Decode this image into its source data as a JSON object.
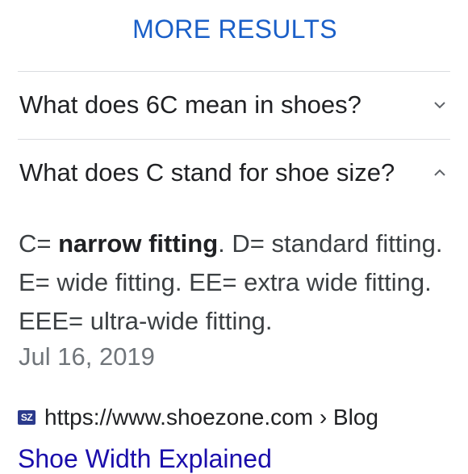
{
  "header": {
    "more_results_label": "MORE RESULTS"
  },
  "questions": [
    {
      "text": "What does 6C mean in shoes?",
      "expanded": false,
      "chevron_icon": "chevron-down-icon"
    },
    {
      "text": "What does C stand for shoe size?",
      "expanded": true,
      "chevron_icon": "chevron-up-icon"
    }
  ],
  "answer": {
    "prefix": "C= ",
    "bold": "narrow fitting",
    "rest": ". D= standard fitting. E= wide fitting. EE= extra wide fitting. EEE= ultra-wide fitting.",
    "date": "Jul 16, 2019"
  },
  "source": {
    "favicon_text": "SZ",
    "url": "https://www.shoezone.com › Blog",
    "title": "Shoe Width Explained"
  },
  "colors": {
    "link_blue": "#1a5fc8",
    "title_blue": "#1a0dab",
    "divider": "#dadce0"
  }
}
